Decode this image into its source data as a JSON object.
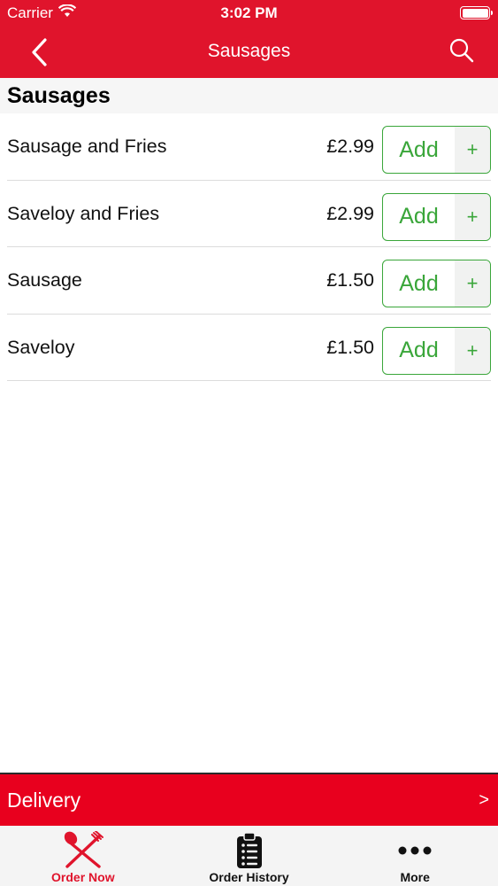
{
  "status_bar": {
    "carrier": "Carrier",
    "time": "3:02 PM",
    "wifi_icon": "wifi-icon",
    "battery_icon": "battery-icon"
  },
  "nav": {
    "title": "Sausages",
    "back_icon": "chevron-left-icon",
    "search_icon": "search-icon"
  },
  "section": {
    "title": "Sausages"
  },
  "items": [
    {
      "name": "Sausage and Fries",
      "price": "£2.99",
      "add_label": "Add",
      "plus": "+"
    },
    {
      "name": "Saveloy and Fries",
      "price": "£2.99",
      "add_label": "Add",
      "plus": "+"
    },
    {
      "name": "Sausage",
      "price": "£1.50",
      "add_label": "Add",
      "plus": "+"
    },
    {
      "name": "Saveloy",
      "price": "£1.50",
      "add_label": "Add",
      "plus": "+"
    }
  ],
  "delivery": {
    "label": "Delivery",
    "arrow": ">"
  },
  "tabs": [
    {
      "label": "Order Now",
      "icon": "fork-knife-icon",
      "active": true
    },
    {
      "label": "Order History",
      "icon": "clipboard-icon",
      "active": false
    },
    {
      "label": "More",
      "icon": "more-dots-icon",
      "active": false
    }
  ],
  "colors": {
    "brand_red": "#e0142c",
    "add_green": "#3aa63a"
  }
}
